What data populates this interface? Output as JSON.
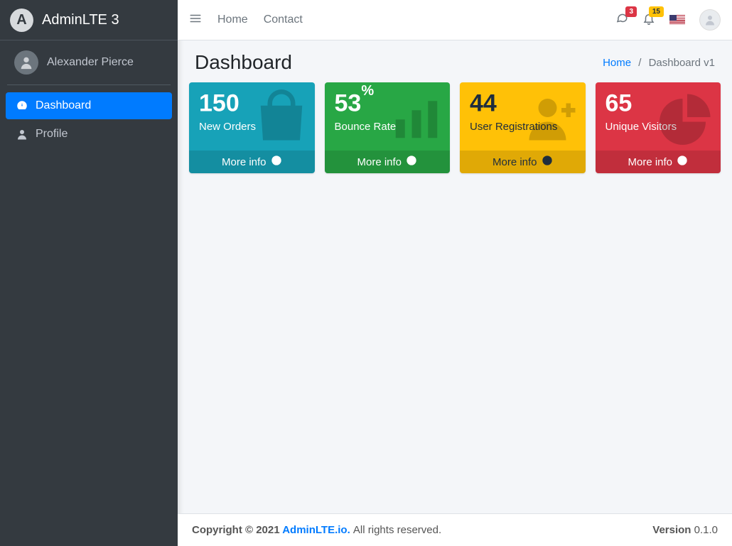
{
  "brand": {
    "name": "AdminLTE 3",
    "logo_letter": "A"
  },
  "user": {
    "name": "Alexander Pierce"
  },
  "sidebar": {
    "items": [
      {
        "label": "Dashboard",
        "icon": "tachometer",
        "active": true
      },
      {
        "label": "Profile",
        "icon": "user",
        "active": false
      }
    ]
  },
  "topbar": {
    "links": [
      "Home",
      "Contact"
    ],
    "notifications": {
      "messages": "3",
      "alerts": "15"
    }
  },
  "header": {
    "title": "Dashboard",
    "breadcrumb": {
      "home": "Home",
      "current": "Dashboard v1"
    }
  },
  "stats": [
    {
      "value": "150",
      "suffix": "",
      "label": "New Orders",
      "link": "More info",
      "theme": "info",
      "icon": "bag"
    },
    {
      "value": "53",
      "suffix": "%",
      "label": "Bounce Rate",
      "link": "More info",
      "theme": "success",
      "icon": "stats"
    },
    {
      "value": "44",
      "suffix": "",
      "label": "User Registrations",
      "link": "More info",
      "theme": "warning",
      "icon": "user-plus"
    },
    {
      "value": "65",
      "suffix": "",
      "label": "Unique Visitors",
      "link": "More info",
      "theme": "danger",
      "icon": "pie"
    }
  ],
  "footer": {
    "copyright_prefix": "Copyright © 2021 ",
    "brand_link": "AdminLTE.io.",
    "rights": " All rights reserved.",
    "version_label": "Version",
    "version": " 0.1.0"
  }
}
